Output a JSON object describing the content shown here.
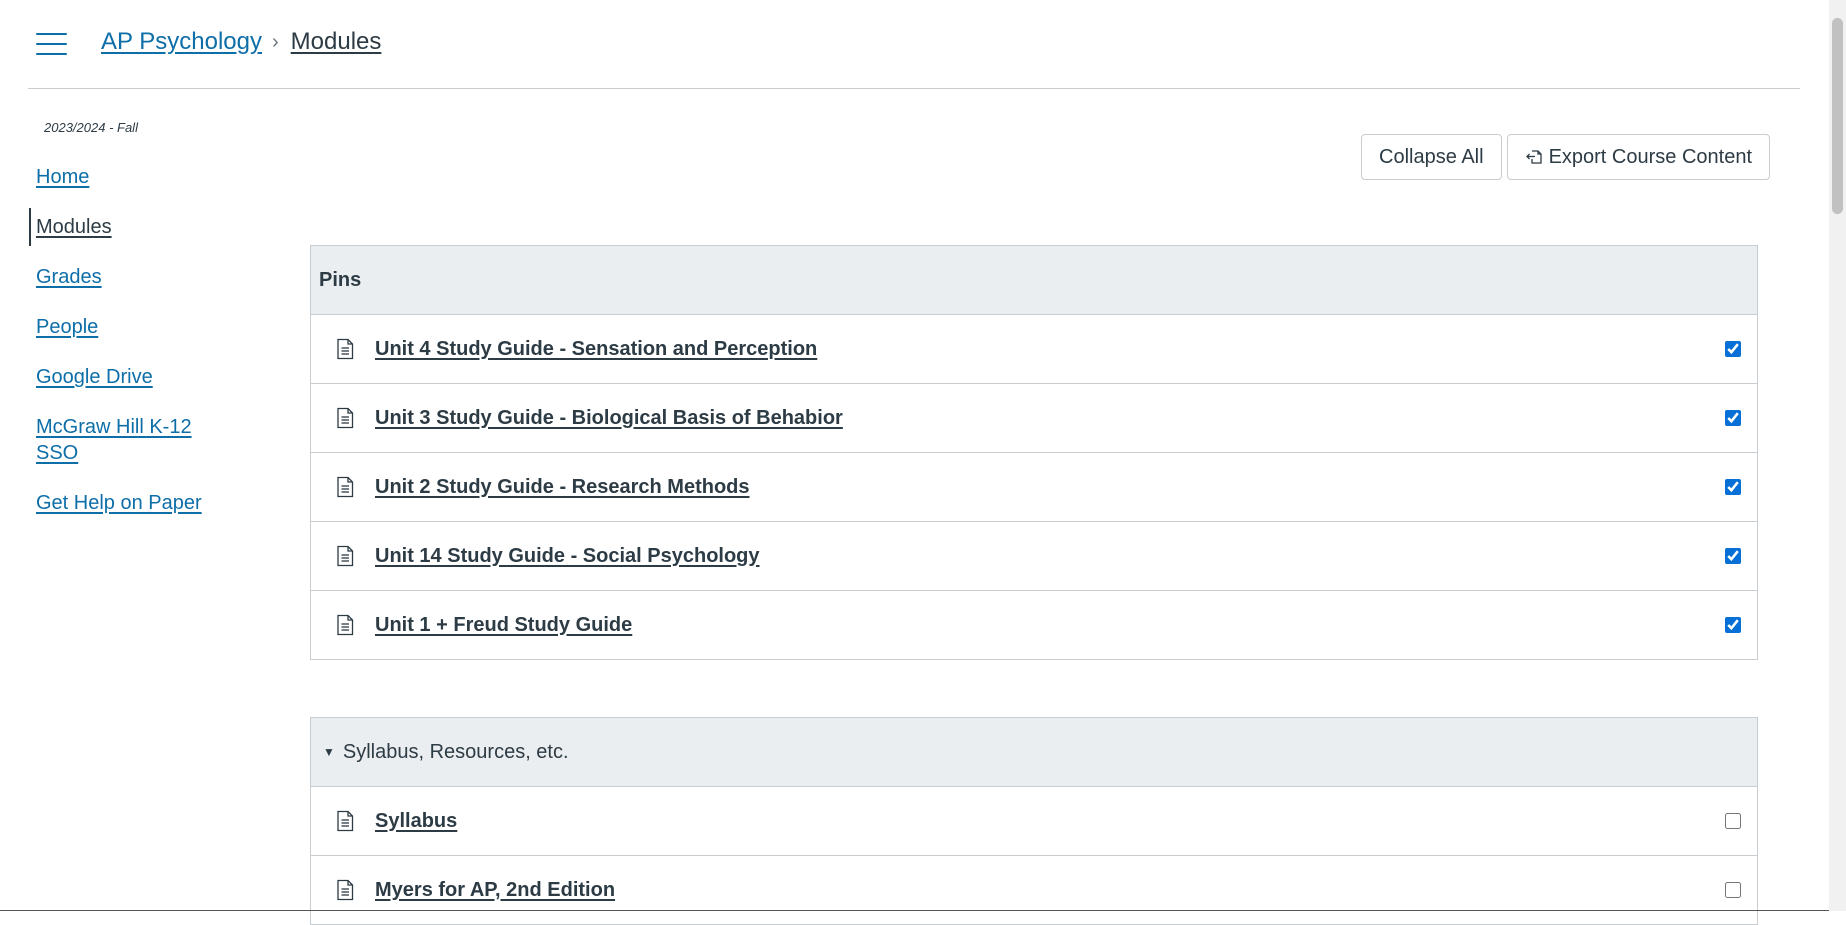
{
  "header": {
    "course_link": "AP Psychology",
    "separator": "›",
    "current": "Modules"
  },
  "nav": {
    "term": "2023/2024 - Fall",
    "items": [
      {
        "label": "Home"
      },
      {
        "label": "Modules"
      },
      {
        "label": "Grades"
      },
      {
        "label": "People"
      },
      {
        "label": "Google Drive"
      },
      {
        "label": "McGraw Hill K-12 SSO"
      },
      {
        "label": "Get Help on Paper"
      }
    ]
  },
  "toolbar": {
    "collapse_label": "Collapse All",
    "export_label": "Export Course Content"
  },
  "modules": [
    {
      "title": "Pins",
      "items": [
        {
          "label": "Unit 4 Study Guide - Sensation and Perception",
          "checked": true
        },
        {
          "label": "Unit 3 Study Guide - Biological Basis of Behabior",
          "checked": true
        },
        {
          "label": "Unit 2 Study Guide - Research Methods",
          "checked": true
        },
        {
          "label": "Unit 14 Study Guide - Social Psychology",
          "checked": true
        },
        {
          "label": "Unit 1 + Freud Study Guide",
          "checked": true
        }
      ]
    },
    {
      "title": "Syllabus, Resources, etc.",
      "items": [
        {
          "label": "Syllabus",
          "checked": false
        },
        {
          "label": "Myers for AP, 2nd Edition",
          "checked": false
        }
      ]
    }
  ],
  "colors": {
    "link": "#0e6ea8",
    "text": "#2d3b45",
    "module_header_bg": "#ebeef0",
    "border": "#c7cdd1",
    "checkbox": "#0770d6"
  }
}
